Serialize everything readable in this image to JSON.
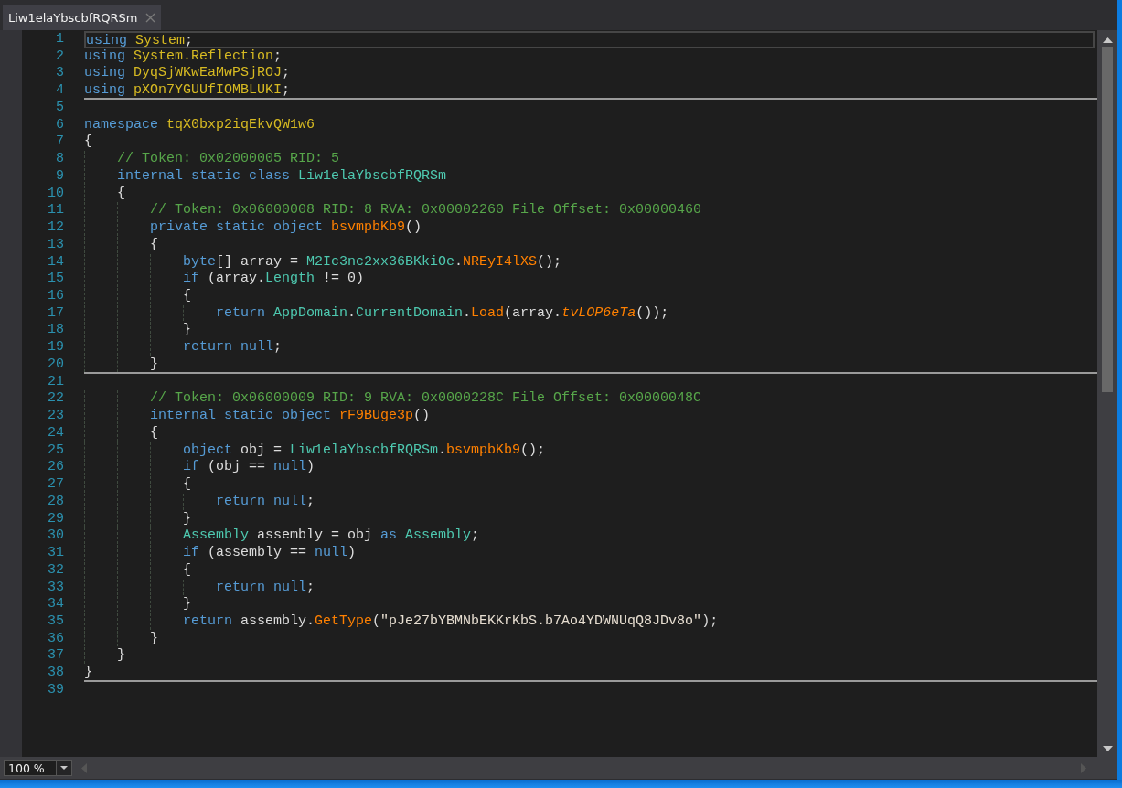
{
  "tab": {
    "title": "Liw1elaYbscbfRQRSm",
    "selected": true
  },
  "lines": [
    {
      "number": "1",
      "current": true,
      "separator": false,
      "tokens": [
        {
          "kind": "kw",
          "text": "using "
        },
        {
          "kind": "ns",
          "text": "System"
        },
        {
          "kind": "plain",
          "text": ";"
        }
      ]
    },
    {
      "number": "2",
      "current": false,
      "separator": false,
      "tokens": [
        {
          "kind": "kw",
          "text": "using "
        },
        {
          "kind": "ns",
          "text": "System.Reflection"
        },
        {
          "kind": "plain",
          "text": ";"
        }
      ]
    },
    {
      "number": "3",
      "current": false,
      "separator": false,
      "tokens": [
        {
          "kind": "kw",
          "text": "using "
        },
        {
          "kind": "ns",
          "text": "DyqSjWKwEaMwPSjROJ"
        },
        {
          "kind": "plain",
          "text": ";"
        }
      ]
    },
    {
      "number": "4",
      "current": false,
      "separator": true,
      "tokens": [
        {
          "kind": "kw",
          "text": "using "
        },
        {
          "kind": "ns",
          "text": "pXOn7YGUUfIOMBLUKI"
        },
        {
          "kind": "plain",
          "text": ";"
        }
      ]
    },
    {
      "number": "5",
      "current": false,
      "separator": false
    },
    {
      "number": "6",
      "current": false,
      "separator": false,
      "tokens": [
        {
          "kind": "kw",
          "text": "namespace "
        },
        {
          "kind": "ns",
          "text": "tqX0bxp2iqEkvQW1w6"
        }
      ]
    },
    {
      "number": "7",
      "current": false,
      "separator": false,
      "tokens": [
        {
          "kind": "plain",
          "text": "{"
        }
      ]
    },
    {
      "number": "8",
      "current": false,
      "separator": false,
      "tokens": [
        {
          "kind": "comment",
          "text": "    // Token: 0x02000005 RID: 5"
        }
      ]
    },
    {
      "number": "9",
      "current": false,
      "separator": false,
      "tokens": [
        {
          "kind": "kw",
          "text": "    internal static class "
        },
        {
          "kind": "type",
          "text": "Liw1elaYbscbfRQRSm"
        }
      ]
    },
    {
      "number": "10",
      "current": false,
      "separator": false,
      "tokens": [
        {
          "kind": "plain",
          "text": "    {"
        }
      ]
    },
    {
      "number": "11",
      "current": false,
      "separator": false,
      "tokens": [
        {
          "kind": "comment",
          "text": "        // Token: 0x06000008 RID: 8 RVA: 0x00002260 File Offset: 0x00000460"
        }
      ]
    },
    {
      "number": "12",
      "current": false,
      "separator": false,
      "tokens": [
        {
          "kind": "kw",
          "text": "        private static object "
        },
        {
          "kind": "method",
          "text": "bsvmpbKb9"
        },
        {
          "kind": "plain",
          "text": "()"
        }
      ]
    },
    {
      "number": "13",
      "current": false,
      "separator": false,
      "tokens": [
        {
          "kind": "plain",
          "text": "        {"
        }
      ]
    },
    {
      "number": "14",
      "current": false,
      "separator": false,
      "tokens": [
        {
          "kind": "kw",
          "text": "            byte"
        },
        {
          "kind": "plain",
          "text": "[] array = "
        },
        {
          "kind": "type",
          "text": "M2Ic3nc2xx36BKkiOe"
        },
        {
          "kind": "plain",
          "text": "."
        },
        {
          "kind": "method",
          "text": "NREyI4lXS"
        },
        {
          "kind": "plain",
          "text": "();"
        }
      ]
    },
    {
      "number": "15",
      "current": false,
      "separator": false,
      "tokens": [
        {
          "kind": "kw",
          "text": "            if"
        },
        {
          "kind": "plain",
          "text": " (array."
        },
        {
          "kind": "type",
          "text": "Length"
        },
        {
          "kind": "plain",
          "text": " != 0)"
        }
      ]
    },
    {
      "number": "16",
      "current": false,
      "separator": false,
      "tokens": [
        {
          "kind": "plain",
          "text": "            {"
        }
      ]
    },
    {
      "number": "17",
      "current": false,
      "separator": false,
      "tokens": [
        {
          "kind": "kw",
          "text": "                return "
        },
        {
          "kind": "type",
          "text": "AppDomain"
        },
        {
          "kind": "plain",
          "text": "."
        },
        {
          "kind": "type",
          "text": "CurrentDomain"
        },
        {
          "kind": "plain",
          "text": "."
        },
        {
          "kind": "method",
          "text": "Load"
        },
        {
          "kind": "plain",
          "text": "(array."
        },
        {
          "kind": "ext",
          "text": "tvLOP6eTa"
        },
        {
          "kind": "plain",
          "text": "());"
        }
      ]
    },
    {
      "number": "18",
      "current": false,
      "separator": false,
      "tokens": [
        {
          "kind": "plain",
          "text": "            }"
        }
      ]
    },
    {
      "number": "19",
      "current": false,
      "separator": false,
      "tokens": [
        {
          "kind": "kw",
          "text": "            return null"
        },
        {
          "kind": "plain",
          "text": ";"
        }
      ]
    },
    {
      "number": "20",
      "current": false,
      "separator": true,
      "tokens": [
        {
          "kind": "plain",
          "text": "        }"
        }
      ]
    },
    {
      "number": "21",
      "current": false,
      "separator": false
    },
    {
      "number": "22",
      "current": false,
      "separator": false,
      "tokens": [
        {
          "kind": "comment",
          "text": "        // Token: 0x06000009 RID: 9 RVA: 0x0000228C File Offset: 0x0000048C"
        }
      ]
    },
    {
      "number": "23",
      "current": false,
      "separator": false,
      "tokens": [
        {
          "kind": "kw",
          "text": "        internal static object "
        },
        {
          "kind": "method",
          "text": "rF9BUge3p"
        },
        {
          "kind": "plain",
          "text": "()"
        }
      ]
    },
    {
      "number": "24",
      "current": false,
      "separator": false,
      "tokens": [
        {
          "kind": "plain",
          "text": "        {"
        }
      ]
    },
    {
      "number": "25",
      "current": false,
      "separator": false,
      "tokens": [
        {
          "kind": "kw",
          "text": "            object"
        },
        {
          "kind": "plain",
          "text": " obj = "
        },
        {
          "kind": "type",
          "text": "Liw1elaYbscbfRQRSm"
        },
        {
          "kind": "plain",
          "text": "."
        },
        {
          "kind": "method",
          "text": "bsvmpbKb9"
        },
        {
          "kind": "plain",
          "text": "();"
        }
      ]
    },
    {
      "number": "26",
      "current": false,
      "separator": false,
      "tokens": [
        {
          "kind": "kw",
          "text": "            if"
        },
        {
          "kind": "plain",
          "text": " (obj == "
        },
        {
          "kind": "kw",
          "text": "null"
        },
        {
          "kind": "plain",
          "text": ")"
        }
      ]
    },
    {
      "number": "27",
      "current": false,
      "separator": false,
      "tokens": [
        {
          "kind": "plain",
          "text": "            {"
        }
      ]
    },
    {
      "number": "28",
      "current": false,
      "separator": false,
      "tokens": [
        {
          "kind": "kw",
          "text": "                return null"
        },
        {
          "kind": "plain",
          "text": ";"
        }
      ]
    },
    {
      "number": "29",
      "current": false,
      "separator": false,
      "tokens": [
        {
          "kind": "plain",
          "text": "            }"
        }
      ]
    },
    {
      "number": "30",
      "current": false,
      "separator": false,
      "tokens": [
        {
          "kind": "type",
          "text": "            Assembly"
        },
        {
          "kind": "plain",
          "text": " assembly = obj "
        },
        {
          "kind": "kw",
          "text": "as "
        },
        {
          "kind": "type",
          "text": "Assembly"
        },
        {
          "kind": "plain",
          "text": ";"
        }
      ]
    },
    {
      "number": "31",
      "current": false,
      "separator": false,
      "tokens": [
        {
          "kind": "kw",
          "text": "            if"
        },
        {
          "kind": "plain",
          "text": " (assembly == "
        },
        {
          "kind": "kw",
          "text": "null"
        },
        {
          "kind": "plain",
          "text": ")"
        }
      ]
    },
    {
      "number": "32",
      "current": false,
      "separator": false,
      "tokens": [
        {
          "kind": "plain",
          "text": "            {"
        }
      ]
    },
    {
      "number": "33",
      "current": false,
      "separator": false,
      "tokens": [
        {
          "kind": "kw",
          "text": "                return null"
        },
        {
          "kind": "plain",
          "text": ";"
        }
      ]
    },
    {
      "number": "34",
      "current": false,
      "separator": false,
      "tokens": [
        {
          "kind": "plain",
          "text": "            }"
        }
      ]
    },
    {
      "number": "35",
      "current": false,
      "separator": false,
      "tokens": [
        {
          "kind": "kw",
          "text": "            return"
        },
        {
          "kind": "plain",
          "text": " assembly."
        },
        {
          "kind": "method",
          "text": "GetType"
        },
        {
          "kind": "plain",
          "text": "("
        },
        {
          "kind": "string",
          "text": "\"pJe27bYBMNbEKKrKbS.b7Ao4YDWNUqQ8JDv8o\""
        },
        {
          "kind": "plain",
          "text": ");"
        }
      ]
    },
    {
      "number": "36",
      "current": false,
      "separator": false,
      "tokens": [
        {
          "kind": "plain",
          "text": "        }"
        }
      ]
    },
    {
      "number": "37",
      "current": false,
      "separator": false,
      "tokens": [
        {
          "kind": "plain",
          "text": "    }"
        }
      ]
    },
    {
      "number": "38",
      "current": false,
      "separator": true,
      "tokens": [
        {
          "kind": "plain",
          "text": "}"
        }
      ]
    },
    {
      "number": "39",
      "current": false,
      "separator": false
    }
  ],
  "zoom": {
    "value": "100 %"
  }
}
